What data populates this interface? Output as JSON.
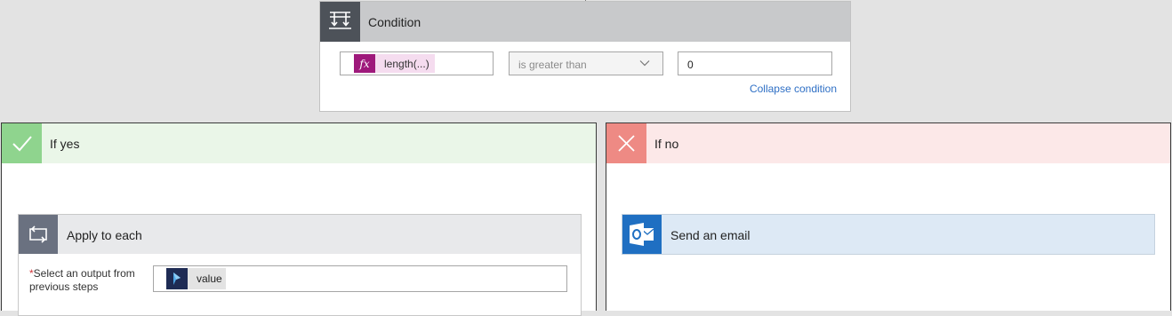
{
  "condition": {
    "title": "Condition",
    "icon": "condition-icon",
    "expression": {
      "fx_symbol": "fx",
      "token_label": "length(...)"
    },
    "operator": "is greater than",
    "value": "0",
    "collapse_link": "Collapse condition"
  },
  "if_yes": {
    "title": "If yes",
    "icon": "checkmark-icon",
    "color": "#8fd48e",
    "apply_to_each": {
      "title": "Apply to each",
      "icon": "loop-icon",
      "required_marker": "*",
      "field_label": "Select an output from previous steps",
      "token_label": "value",
      "token_icon": "dynamics-icon"
    }
  },
  "if_no": {
    "title": "If no",
    "icon": "close-icon",
    "color": "#ee8a84",
    "send_email": {
      "title": "Send an email",
      "icon": "outlook-icon"
    }
  }
}
